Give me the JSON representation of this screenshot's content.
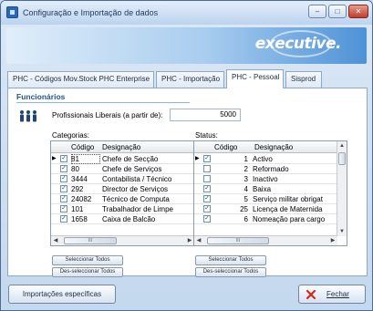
{
  "window": {
    "title": "Configuração e Importação de dados",
    "minimize": "–",
    "maximize": "□",
    "close": "✕"
  },
  "banner": {
    "logo_text": "executive."
  },
  "tabs": [
    {
      "label": "PHC - Códigos Mov.Stock PHC Enterprise"
    },
    {
      "label": "PHC - Importação"
    },
    {
      "label": "PHC - Pessoal"
    },
    {
      "label": "Sisprod"
    }
  ],
  "section": {
    "title": "Funcionários"
  },
  "profissionais": {
    "label": "Profissionais Liberais (a partir de):",
    "value": "5000"
  },
  "categorias": {
    "label": "Categorias:",
    "headers": {
      "codigo": "Código",
      "designacao": "Designação"
    },
    "rows": [
      {
        "codigo": "81",
        "designacao": "Chefe de Secção"
      },
      {
        "codigo": "80",
        "designacao": "Chefe de Serviços"
      },
      {
        "codigo": "3444",
        "designacao": "Contabilista / Técnico"
      },
      {
        "codigo": "292",
        "designacao": "Director de Serviços"
      },
      {
        "codigo": "24082",
        "designacao": "Técnico de Computa"
      },
      {
        "codigo": "101",
        "designacao": "Trabalhador de Limpe"
      },
      {
        "codigo": "1658",
        "designacao": "Caixa de Balcão"
      }
    ],
    "select_all": "Seleccionar Todos",
    "deselect_all": "Des-seleccionar Todos"
  },
  "status": {
    "label": "Status:",
    "headers": {
      "codigo": "Código",
      "designacao": "Designação"
    },
    "rows": [
      {
        "codigo": "1",
        "designacao": "Activo",
        "checked": true
      },
      {
        "codigo": "2",
        "designacao": "Reformado",
        "checked": false
      },
      {
        "codigo": "3",
        "designacao": "Inactivo",
        "checked": false
      },
      {
        "codigo": "4",
        "designacao": "Baixa",
        "checked": true
      },
      {
        "codigo": "5",
        "designacao": "Serviço militar obrigat",
        "checked": true
      },
      {
        "codigo": "25",
        "designacao": "Licença de Maternida",
        "checked": true
      },
      {
        "codigo": "6",
        "designacao": "Nomeação para cargo",
        "checked": true
      }
    ],
    "select_all": "Seleccionar Todos",
    "deselect_all": "Des-seleccionar Todos"
  },
  "buttons": {
    "importacoes": "Importações específicas",
    "fechar": "Fechar"
  },
  "glyphs": {
    "row_pointer": "▶",
    "check": "✓",
    "scroll_up": "▲",
    "scroll_down": "▼",
    "scroll_left": "◀",
    "scroll_right": "▶",
    "grip": "III"
  },
  "colors": {
    "accent": "#21558f",
    "fechar_icon": "#d8261b"
  }
}
